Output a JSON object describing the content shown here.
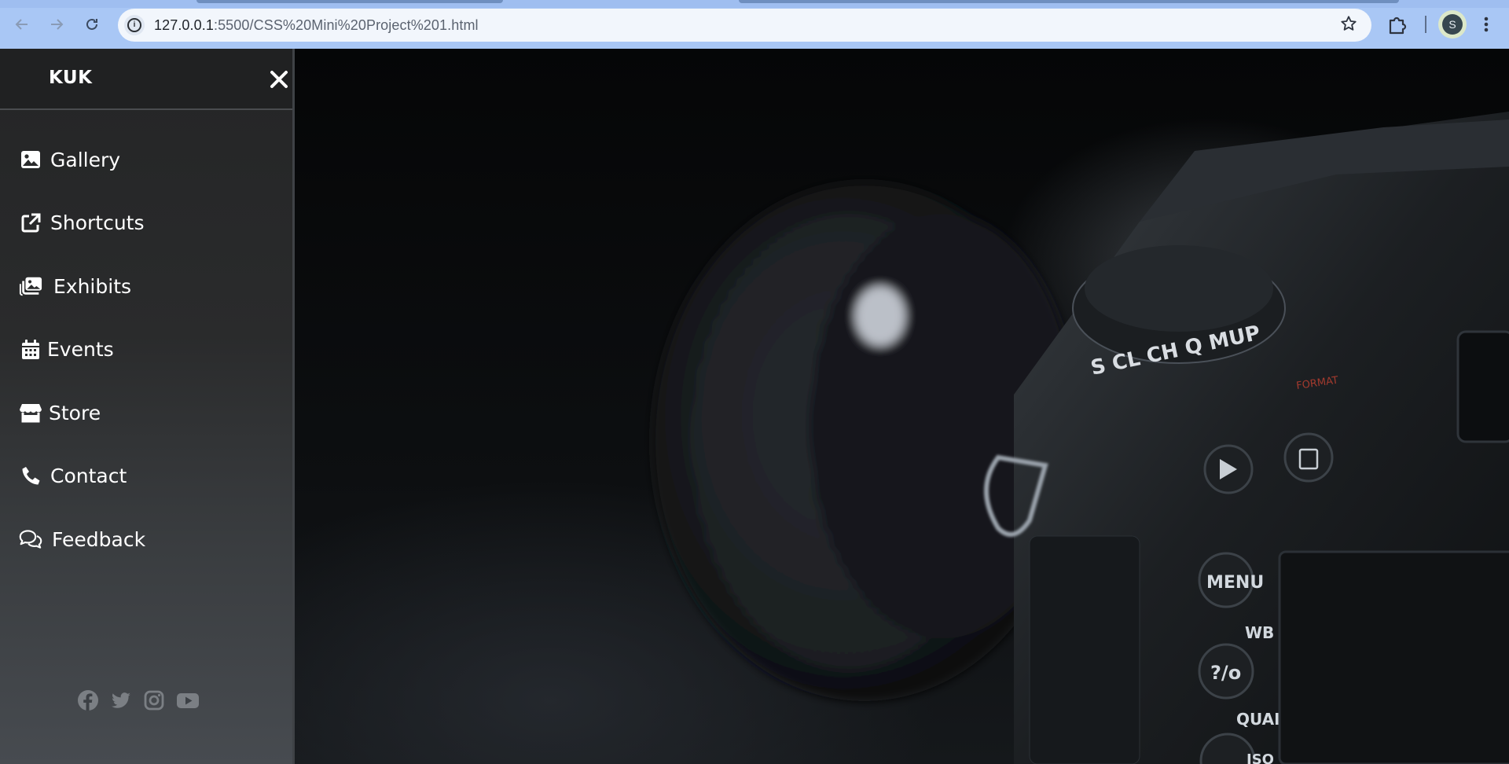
{
  "browser": {
    "url_host": "127.0.0.1",
    "url_path": ":5500/CSS%20Mini%20Project%201.html",
    "profile_initial": "S",
    "icons": {
      "back": "arrow-left-icon",
      "forward": "arrow-right-icon",
      "reload": "reload-icon",
      "site_info": "info-icon",
      "bookmark": "star-icon",
      "extensions": "puzzle-icon",
      "menu": "kebab-icon"
    }
  },
  "sidebar": {
    "brand": "KUK",
    "close_icon": "close-icon",
    "items": [
      {
        "label": "Gallery",
        "icon": "image-icon"
      },
      {
        "label": "Shortcuts",
        "icon": "external-link-icon"
      },
      {
        "label": "Exhibits",
        "icon": "photo-stack-icon"
      },
      {
        "label": "Events",
        "icon": "calendar-icon"
      },
      {
        "label": "Store",
        "icon": "store-icon"
      },
      {
        "label": "Contact",
        "icon": "phone-icon"
      },
      {
        "label": "Feedback",
        "icon": "chat-icon"
      }
    ],
    "socials": [
      "facebook-icon",
      "twitter-icon",
      "instagram-icon",
      "youtube-icon"
    ]
  },
  "hero": {
    "camera_labels": {
      "menu": "MENU",
      "wb": "WB",
      "qual": "QUAL",
      "iso": "ISO",
      "format": "FORMAT",
      "dial": "S CL CH Q MUP"
    }
  },
  "colors": {
    "sidebar_top": "#242526",
    "sidebar_bottom": "#474b50",
    "chrome": "#a9c7f5",
    "omnibox": "#f2f6fc",
    "social": "#7b7f84"
  }
}
